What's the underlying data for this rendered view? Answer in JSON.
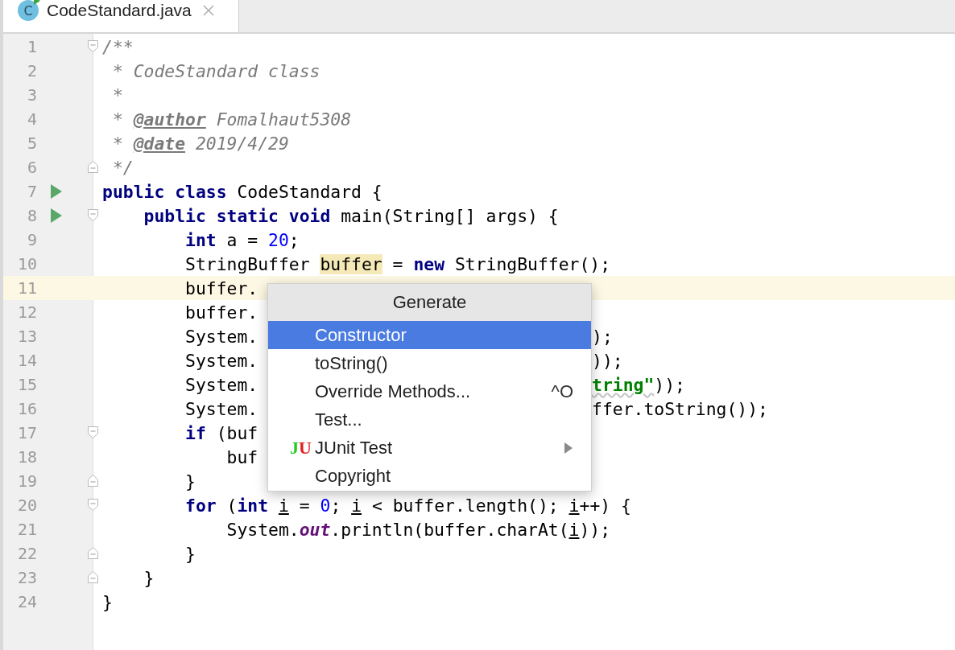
{
  "tab": {
    "title": "CodeStandard.java",
    "icon_letter": "C",
    "selected": true
  },
  "editor": {
    "lines": [
      {
        "number": "1",
        "run": false,
        "fold": {
          "kind": "start"
        },
        "current": false,
        "tokens": [
          {
            "kind": "comment",
            "t": "/**"
          }
        ]
      },
      {
        "number": "2",
        "run": false,
        "current": false,
        "tokens": [
          {
            "kind": "comment",
            "t": " * CodeStandard class"
          }
        ]
      },
      {
        "number": "3",
        "run": false,
        "current": false,
        "tokens": [
          {
            "kind": "comment",
            "t": " *"
          }
        ]
      },
      {
        "number": "4",
        "run": false,
        "current": false,
        "tokens": [
          {
            "kind": "comment",
            "t": " * "
          },
          {
            "kind": "doctag",
            "t": "@author"
          },
          {
            "kind": "comment",
            "t": " Fomalhaut5308"
          }
        ]
      },
      {
        "number": "5",
        "run": false,
        "current": false,
        "tokens": [
          {
            "kind": "comment",
            "t": " * "
          },
          {
            "kind": "doctag",
            "t": "@date"
          },
          {
            "kind": "comment",
            "t": " 2019/4/29"
          }
        ]
      },
      {
        "number": "6",
        "run": false,
        "fold": {
          "kind": "end"
        },
        "current": false,
        "tokens": [
          {
            "kind": "comment",
            "t": " */"
          }
        ]
      },
      {
        "number": "7",
        "run": true,
        "current": false,
        "tokens": [
          {
            "kind": "keyword",
            "t": "public class"
          },
          {
            "kind": "plain",
            "t": " CodeStandard {"
          }
        ]
      },
      {
        "number": "8",
        "run": true,
        "fold": {
          "kind": "start"
        },
        "current": false,
        "tokens": [
          {
            "kind": "keyword",
            "t": "    public static void"
          },
          {
            "kind": "plain",
            "t": " main(String[] args) {"
          }
        ]
      },
      {
        "number": "9",
        "run": false,
        "current": false,
        "tokens": [
          {
            "kind": "keyword",
            "t": "        int"
          },
          {
            "kind": "plain",
            "t": " a = "
          },
          {
            "kind": "number",
            "t": "20"
          },
          {
            "kind": "plain",
            "t": ";"
          }
        ]
      },
      {
        "number": "10",
        "run": false,
        "current": false,
        "tokens": [
          {
            "kind": "plain",
            "t": "        StringBuffer "
          },
          {
            "kind": "highlight",
            "t": "buffer"
          },
          {
            "kind": "plain",
            "t": " = "
          },
          {
            "kind": "keyword",
            "t": "new"
          },
          {
            "kind": "plain",
            "t": " StringBuffer();"
          }
        ]
      },
      {
        "number": "11",
        "run": false,
        "current": true,
        "tokens": [
          {
            "kind": "plain",
            "t": "        buffer."
          }
        ]
      },
      {
        "number": "12",
        "run": false,
        "current": false,
        "tokens": [
          {
            "kind": "plain",
            "t": "        buffer."
          }
        ]
      },
      {
        "number": "13",
        "run": false,
        "current": false,
        "tokens": [
          {
            "kind": "plain",
            "t": "        System."
          }
        ],
        "tail": [
          {
            "kind": "plain",
            "t": ");"
          }
        ]
      },
      {
        "number": "14",
        "run": false,
        "current": false,
        "tokens": [
          {
            "kind": "plain",
            "t": "        System."
          }
        ],
        "tail": [
          {
            "kind": "plain",
            "t": "));"
          }
        ]
      },
      {
        "number": "15",
        "run": false,
        "current": false,
        "tokens": [
          {
            "kind": "plain",
            "t": "        System."
          }
        ],
        "tail": [
          {
            "kind": "string",
            "t": "tring\""
          },
          {
            "kind": "plain",
            "t": "));"
          }
        ]
      },
      {
        "number": "16",
        "run": false,
        "current": false,
        "tokens": [
          {
            "kind": "plain",
            "t": "        System."
          }
        ],
        "tail": [
          {
            "kind": "plain",
            "t": "ffer.toString());"
          }
        ]
      },
      {
        "number": "17",
        "run": false,
        "fold": {
          "kind": "start"
        },
        "current": false,
        "tokens": [
          {
            "kind": "keyword",
            "t": "        if"
          },
          {
            "kind": "plain",
            "t": " (buf"
          }
        ]
      },
      {
        "number": "18",
        "run": false,
        "current": false,
        "tokens": [
          {
            "kind": "plain",
            "t": "            buf"
          }
        ]
      },
      {
        "number": "19",
        "run": false,
        "fold": {
          "kind": "end"
        },
        "current": false,
        "tokens": [
          {
            "kind": "plain",
            "t": "        }"
          }
        ]
      },
      {
        "number": "20",
        "run": false,
        "fold": {
          "kind": "start"
        },
        "current": false,
        "tokens": [
          {
            "kind": "keyword",
            "t": "        for"
          },
          {
            "kind": "plain",
            "t": " ("
          },
          {
            "kind": "keyword",
            "t": "int "
          },
          {
            "kind": "reassigned",
            "t": "i"
          },
          {
            "kind": "plain",
            "t": " = "
          },
          {
            "kind": "number",
            "t": "0"
          },
          {
            "kind": "plain",
            "t": "; "
          },
          {
            "kind": "reassigned",
            "t": "i"
          },
          {
            "kind": "plain",
            "t": " < buffer.length(); "
          },
          {
            "kind": "reassigned",
            "t": "i"
          },
          {
            "kind": "plain",
            "t": "++) {"
          }
        ]
      },
      {
        "number": "21",
        "run": false,
        "current": false,
        "tokens": [
          {
            "kind": "plain",
            "t": "            System."
          },
          {
            "kind": "static",
            "t": "out"
          },
          {
            "kind": "plain",
            "t": ".println(buffer.charAt("
          },
          {
            "kind": "reassigned",
            "t": "i"
          },
          {
            "kind": "plain",
            "t": "));"
          }
        ]
      },
      {
        "number": "22",
        "run": false,
        "fold": {
          "kind": "end"
        },
        "current": false,
        "tokens": [
          {
            "kind": "plain",
            "t": "        }"
          }
        ]
      },
      {
        "number": "23",
        "run": false,
        "fold": {
          "kind": "end"
        },
        "current": false,
        "tokens": [
          {
            "kind": "plain",
            "t": "    }"
          }
        ]
      },
      {
        "number": "24",
        "run": false,
        "current": false,
        "tokens": [
          {
            "kind": "plain",
            "t": "}"
          }
        ]
      }
    ]
  },
  "popup": {
    "title": "Generate",
    "items": [
      {
        "label": "Constructor",
        "selected": true
      },
      {
        "label": "toString()",
        "selected": false
      },
      {
        "label": "Override Methods...",
        "shortcut": "^O",
        "selected": false
      },
      {
        "label": "Test...",
        "selected": false
      },
      {
        "label": "JUnit Test",
        "icon_text": "JU",
        "submenu": true,
        "selected": false
      },
      {
        "label": "Copyright",
        "selected": false
      }
    ]
  }
}
